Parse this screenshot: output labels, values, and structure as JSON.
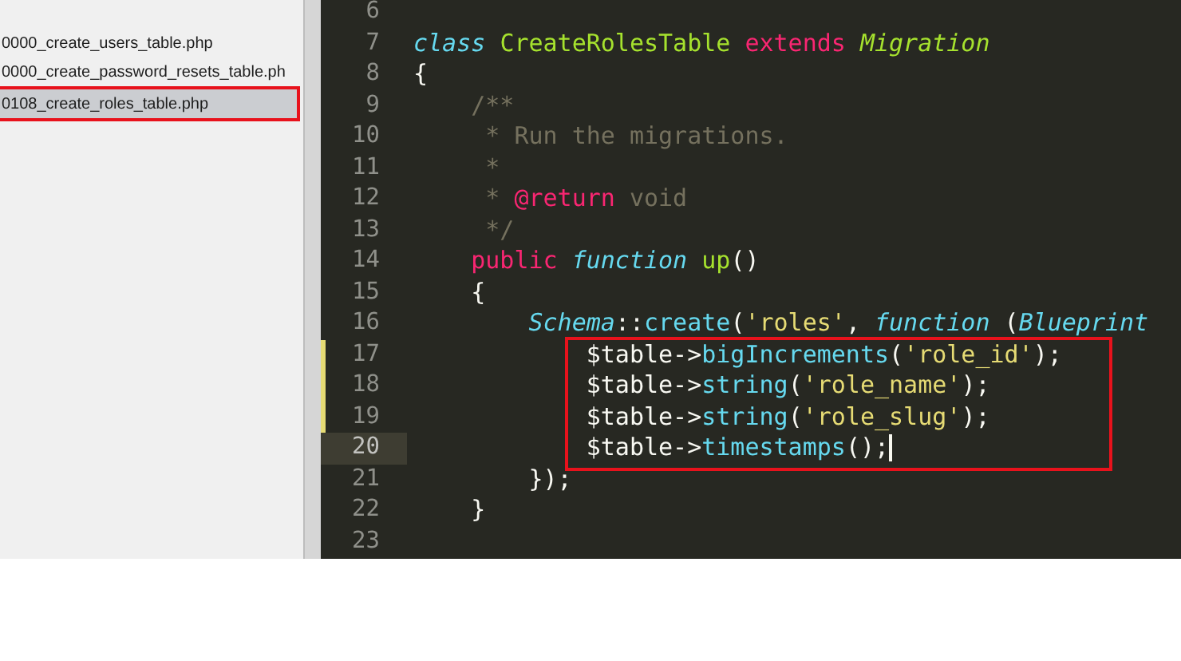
{
  "sidebar": {
    "files": [
      {
        "name": "0000_create_users_table.php",
        "selected": false
      },
      {
        "name": "0000_create_password_resets_table.ph",
        "selected": false
      },
      {
        "name": "0108_create_roles_table.php",
        "selected": true
      }
    ]
  },
  "editor": {
    "lines": [
      {
        "number": "6",
        "current": false,
        "modified": false,
        "boxed": false
      },
      {
        "number": "7",
        "current": false,
        "modified": false,
        "boxed": false,
        "tokens": [
          {
            "kind": "storage",
            "text": "class "
          },
          {
            "kind": "entity",
            "text": "CreateRolesTable "
          },
          {
            "kind": "keyword",
            "text": "extends "
          },
          {
            "kind": "entity-italic",
            "text": "Migration"
          }
        ]
      },
      {
        "number": "8",
        "current": false,
        "modified": false,
        "boxed": false,
        "tokens": [
          {
            "kind": "plain",
            "text": "{"
          }
        ]
      },
      {
        "number": "9",
        "current": false,
        "modified": false,
        "boxed": false,
        "tokens": [
          {
            "kind": "comment",
            "text": "    /**"
          }
        ]
      },
      {
        "number": "10",
        "current": false,
        "modified": false,
        "boxed": false,
        "tokens": [
          {
            "kind": "comment",
            "text": "     * Run the migrations."
          }
        ]
      },
      {
        "number": "11",
        "current": false,
        "modified": false,
        "boxed": false,
        "tokens": [
          {
            "kind": "comment",
            "text": "     *"
          }
        ]
      },
      {
        "number": "12",
        "current": false,
        "modified": false,
        "boxed": false,
        "tokens": [
          {
            "kind": "comment",
            "text": "     * "
          },
          {
            "kind": "keyword",
            "text": "@return"
          },
          {
            "kind": "comment",
            "text": " void"
          }
        ]
      },
      {
        "number": "13",
        "current": false,
        "modified": false,
        "boxed": false,
        "tokens": [
          {
            "kind": "comment",
            "text": "     */"
          }
        ]
      },
      {
        "number": "14",
        "current": false,
        "modified": false,
        "boxed": false,
        "tokens": [
          {
            "kind": "keyword",
            "text": "    public "
          },
          {
            "kind": "storage",
            "text": "function "
          },
          {
            "kind": "entity",
            "text": "up"
          },
          {
            "kind": "plain",
            "text": "()"
          }
        ]
      },
      {
        "number": "15",
        "current": false,
        "modified": false,
        "boxed": false,
        "tokens": [
          {
            "kind": "plain",
            "text": "    {"
          }
        ]
      },
      {
        "number": "16",
        "current": false,
        "modified": false,
        "boxed": false,
        "tokens": [
          {
            "kind": "support-italic",
            "text": "        Schema"
          },
          {
            "kind": "plain",
            "text": "::"
          },
          {
            "kind": "support",
            "text": "create"
          },
          {
            "kind": "plain",
            "text": "("
          },
          {
            "kind": "string",
            "text": "'roles'"
          },
          {
            "kind": "plain",
            "text": ", "
          },
          {
            "kind": "storage",
            "text": "function "
          },
          {
            "kind": "plain",
            "text": "("
          },
          {
            "kind": "support-italic",
            "text": "Blueprint"
          }
        ]
      },
      {
        "number": "17",
        "current": false,
        "modified": true,
        "boxed": true,
        "tokens": [
          {
            "kind": "plain",
            "text": "            $table->"
          },
          {
            "kind": "support",
            "text": "bigIncrements"
          },
          {
            "kind": "plain",
            "text": "("
          },
          {
            "kind": "string",
            "text": "'role_id'"
          },
          {
            "kind": "plain",
            "text": ");"
          }
        ]
      },
      {
        "number": "18",
        "current": false,
        "modified": true,
        "boxed": true,
        "tokens": [
          {
            "kind": "plain",
            "text": "            $table->"
          },
          {
            "kind": "support",
            "text": "string"
          },
          {
            "kind": "plain",
            "text": "("
          },
          {
            "kind": "string",
            "text": "'role_name'"
          },
          {
            "kind": "plain",
            "text": ");"
          }
        ]
      },
      {
        "number": "19",
        "current": false,
        "modified": true,
        "boxed": true,
        "tokens": [
          {
            "kind": "plain",
            "text": "            $table->"
          },
          {
            "kind": "support",
            "text": "string"
          },
          {
            "kind": "plain",
            "text": "("
          },
          {
            "kind": "string",
            "text": "'role_slug'"
          },
          {
            "kind": "plain",
            "text": ");"
          }
        ]
      },
      {
        "number": "20",
        "current": true,
        "modified": false,
        "boxed": true,
        "tokens": [
          {
            "kind": "plain",
            "text": "            $table->"
          },
          {
            "kind": "support",
            "text": "timestamps"
          },
          {
            "kind": "plain",
            "text": "();"
          }
        ]
      },
      {
        "number": "21",
        "current": false,
        "modified": false,
        "boxed": false,
        "tokens": [
          {
            "kind": "plain",
            "text": "        });"
          }
        ]
      },
      {
        "number": "22",
        "current": false,
        "modified": false,
        "boxed": false,
        "tokens": [
          {
            "kind": "plain",
            "text": "    }"
          }
        ]
      },
      {
        "number": "23",
        "current": false,
        "modified": false,
        "boxed": false
      }
    ]
  }
}
